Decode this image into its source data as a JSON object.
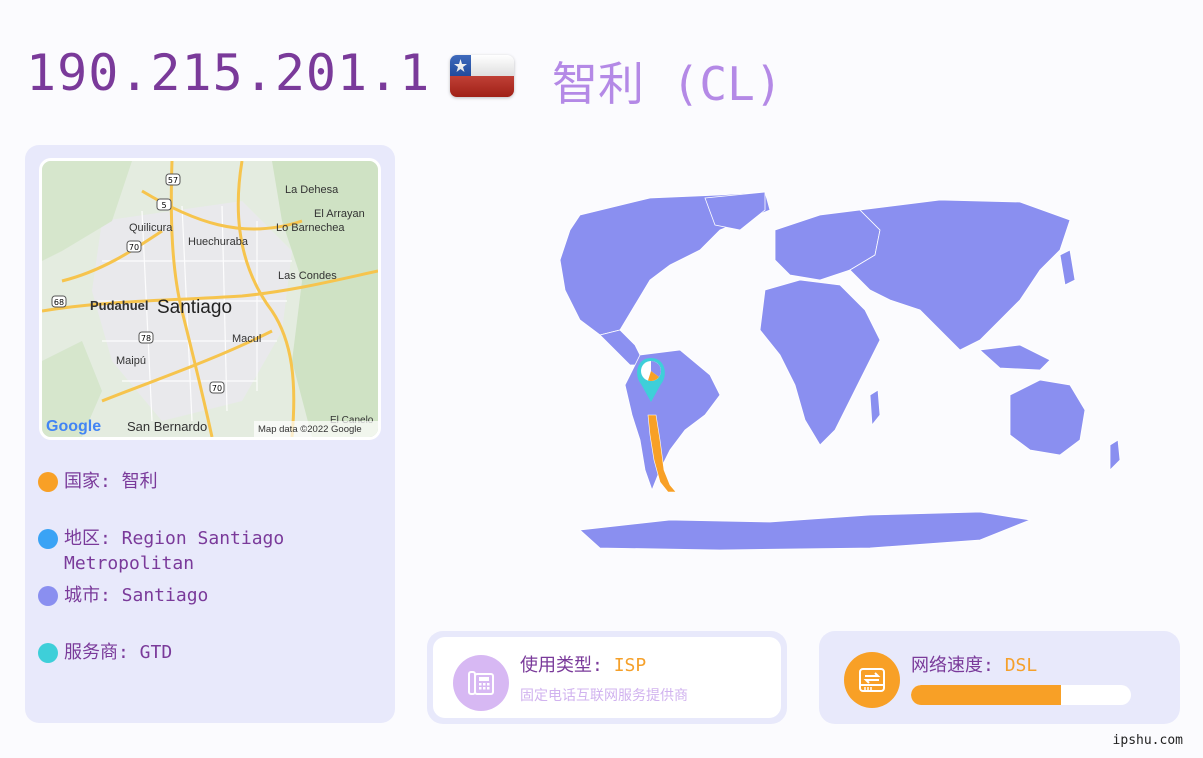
{
  "header": {
    "ip": "190.215.201.1",
    "country_title": "智利 (CL)"
  },
  "mini_map": {
    "places": {
      "la_dehesa": "La Dehesa",
      "el_arrayan": "El Arrayan",
      "quilicura": "Quilicura",
      "lo_barnechea": "Lo Barnechea",
      "huechuraba": "Huechuraba",
      "las_condes": "Las Condes",
      "pudahuel": "Pudahuel",
      "santiago": "Santiago",
      "macul": "Macul",
      "maipu": "Maipú",
      "san_bernardo": "San Bernardo",
      "el_canelo": "El Canelo"
    },
    "shields": [
      "57",
      "5",
      "70",
      "68",
      "78",
      "70"
    ],
    "google": "Google",
    "attribution": "Map data ©2022 Google"
  },
  "info": {
    "country": "国家: 智利",
    "region_line1": "地区: Region Santiago",
    "region_line2": "Metropolitan",
    "city": "城市: Santiago",
    "isp": "服务商: GTD"
  },
  "usage": {
    "label": "使用类型: ",
    "value": "ISP",
    "sub": "固定电话互联网服务提供商"
  },
  "speed": {
    "label": "网络速度: ",
    "value": "DSL",
    "level_fraction": 0.68
  },
  "footer": "ipshu.com",
  "colors": {
    "purple_title": "#7a3a9a",
    "lilac": "#b489e6",
    "orange": "#f8a026",
    "blue": "#3aa3f5",
    "periwinkle": "#8a8ff0",
    "teal": "#3ecfd9",
    "land": "#8a8ff0"
  }
}
